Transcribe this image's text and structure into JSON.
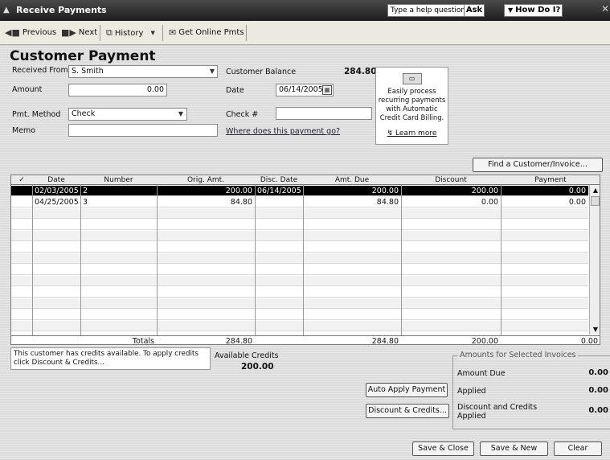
{
  "window": {
    "title": "Receive Payments",
    "help_placeholder": "Type a help question",
    "ask_label": "Ask",
    "how_do_i_label": "How Do I?"
  },
  "toolbar": {
    "previous": "Previous",
    "next": "Next",
    "history": "History",
    "get_online": "Get Online Pmts"
  },
  "form": {
    "heading": "Customer Payment",
    "received_from_label": "Received From",
    "received_from_value": "S. Smith",
    "customer_balance_label": "Customer Balance",
    "customer_balance_value": "284.80",
    "amount_label": "Amount",
    "amount_value": "0.00",
    "date_label": "Date",
    "date_value": "06/14/2005",
    "pmt_method_label": "Pmt. Method",
    "pmt_method_value": "Check",
    "check_label": "Check #",
    "check_value": "",
    "memo_label": "Memo",
    "memo_value": "",
    "where_link": "Where does this payment go?",
    "find_button": "Find a Customer/Invoice..."
  },
  "ad": {
    "text": "Easily process recurring payments with Automatic Credit Card Billing.",
    "learn_more": "Learn more"
  },
  "grid": {
    "columns": [
      "✓",
      "Date",
      "Number",
      "Orig. Amt.",
      "Disc. Date",
      "Amt. Due",
      "Discount",
      "Payment"
    ],
    "rows": [
      {
        "check": "",
        "date": "02/03/2005",
        "number": "2",
        "orig": "200.00",
        "disc_date": "06/14/2005",
        "due": "200.00",
        "discount": "200.00",
        "payment": "0.00"
      },
      {
        "check": "",
        "date": "04/25/2005",
        "number": "3",
        "orig": "84.80",
        "disc_date": "",
        "due": "84.80",
        "discount": "0.00",
        "payment": "0.00"
      }
    ],
    "totals": {
      "label": "Totals",
      "orig": "284.80",
      "due": "284.80",
      "discount": "200.00",
      "payment": "0.00"
    }
  },
  "credits": {
    "note": "This customer has credits available. To apply credits click Discount & Credits...",
    "available_label": "Available Credits",
    "available_value": "200.00"
  },
  "amounts": {
    "legend": "Amounts for Selected Invoices",
    "amount_due_label": "Amount Due",
    "amount_due_value": "0.00",
    "applied_label": "Applied",
    "applied_value": "0.00",
    "disc_label": "Discount and Credits Applied",
    "disc_value": "0.00"
  },
  "buttons": {
    "auto_apply": "Auto Apply Payment",
    "discount_credits": "Discount & Credits...",
    "save_close": "Save & Close",
    "save_new": "Save & New",
    "clear": "Clear"
  }
}
